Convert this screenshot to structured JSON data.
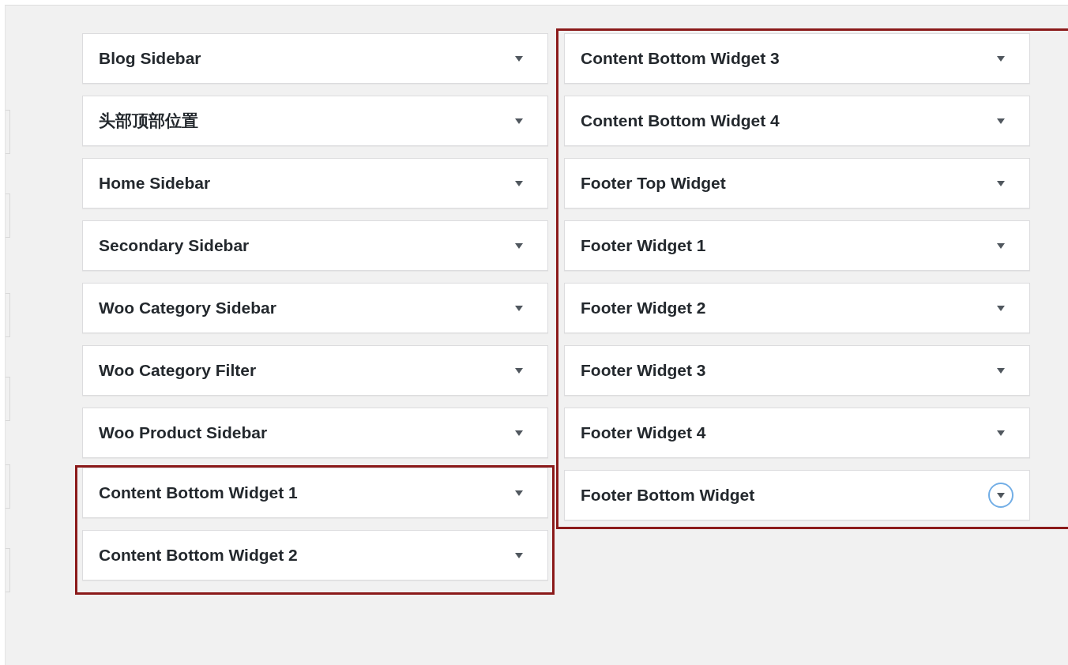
{
  "columns": [
    {
      "groups": [
        {
          "highlighted": false,
          "areas": [
            {
              "title": "Blog Sidebar",
              "focused": false
            },
            {
              "title": "头部顶部位置",
              "focused": false
            },
            {
              "title": "Home Sidebar",
              "focused": false
            },
            {
              "title": "Secondary Sidebar",
              "focused": false
            },
            {
              "title": "Woo Category Sidebar",
              "focused": false
            },
            {
              "title": "Woo Category Filter",
              "focused": false
            },
            {
              "title": "Woo Product Sidebar",
              "focused": false
            }
          ]
        },
        {
          "highlighted": true,
          "areas": [
            {
              "title": "Content Bottom Widget 1",
              "focused": false
            },
            {
              "title": "Content Bottom Widget 2",
              "focused": false
            }
          ]
        }
      ]
    },
    {
      "groups": [
        {
          "highlighted": true,
          "areas": [
            {
              "title": "Content Bottom Widget 3",
              "focused": false
            },
            {
              "title": "Content Bottom Widget 4",
              "focused": false
            },
            {
              "title": "Footer Top Widget",
              "focused": false
            },
            {
              "title": "Footer Widget 1",
              "focused": false
            },
            {
              "title": "Footer Widget 2",
              "focused": false
            },
            {
              "title": "Footer Widget 3",
              "focused": false
            },
            {
              "title": "Footer Widget 4",
              "focused": false
            },
            {
              "title": "Footer Bottom Widget",
              "focused": true
            }
          ]
        }
      ]
    }
  ]
}
